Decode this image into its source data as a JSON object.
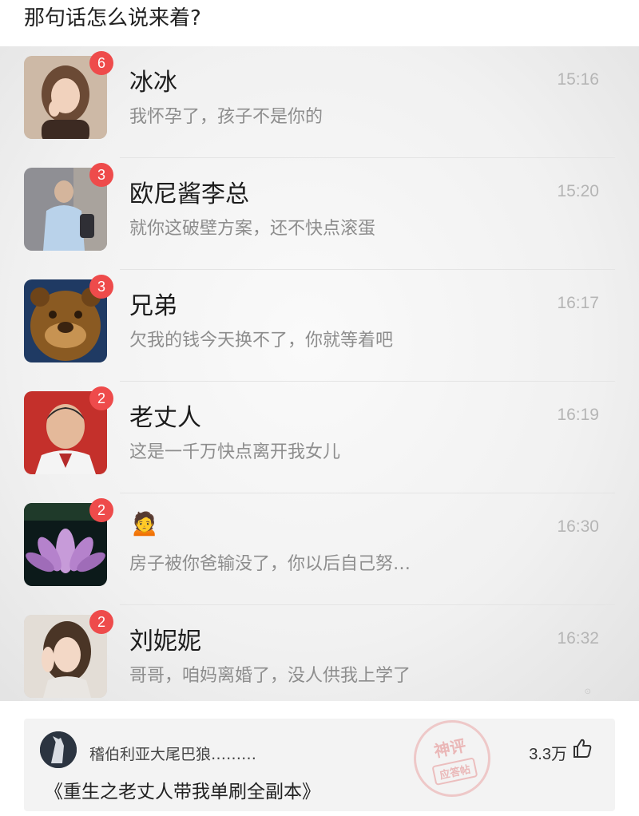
{
  "post": {
    "title": "那句话怎么说来着?"
  },
  "chats": [
    {
      "name": "冰冰",
      "preview": "我怀孕了，孩子不是你的",
      "time": "15:16",
      "unread": "6",
      "avatar": "woman-portrait-avatar"
    },
    {
      "name": "欧尼酱李总",
      "preview": "就你这破壁方案，还不快点滚蛋",
      "time": "15:20",
      "unread": "3",
      "avatar": "man-in-jacket-avatar"
    },
    {
      "name": "兄弟",
      "preview": "欠我的钱今天换不了，你就等着吧",
      "time": "16:17",
      "unread": "3",
      "avatar": "cartoon-bear-avatar"
    },
    {
      "name": "老丈人",
      "preview": "这是一千万快点离开我女儿",
      "time": "16:19",
      "unread": "2",
      "avatar": "older-man-portrait-avatar"
    },
    {
      "name": "🙍",
      "preview": "房子被你爸输没了，你以后自己努…",
      "time": "16:30",
      "unread": "2",
      "avatar": "lotus-flower-avatar"
    },
    {
      "name": "刘妮妮",
      "preview": "哥哥，咱妈离婚了，没人供我上学了",
      "time": "16:32",
      "unread": "2",
      "avatar": "girl-portrait-avatar"
    }
  ],
  "comment": {
    "author": "稽伯利亚大尾巴狼………",
    "likes": "3.3万",
    "text": "《重生之老丈人带我单刷全副本》"
  },
  "stamp": {
    "main": "神评",
    "sub": "应答帖"
  },
  "colors": {
    "badge": "#ee4b4b",
    "preview": "#8d8d8d",
    "time": "#b5b5b5"
  }
}
